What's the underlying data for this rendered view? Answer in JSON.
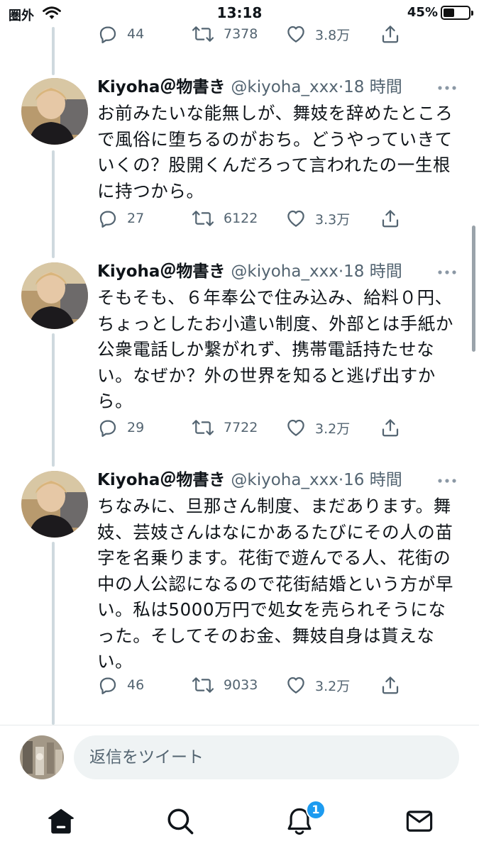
{
  "status_bar": {
    "carrier": "圏外",
    "time": "13:18",
    "battery_percent": "45%",
    "battery_level": 0.45
  },
  "top_actions": {
    "reply_count": "44",
    "retweet_count": "7378",
    "like_count": "3.8万"
  },
  "tweets": [
    {
      "name": "Kiyoha＠物書き",
      "handle": "@kiyoha_xxx",
      "time": "18 時間",
      "text": "お前みたいな能無しが、舞妓を辞めたところで風俗に堕ちるのがおち。どうやっていきていくの？股開くんだろって言われたの一生根に持つから。",
      "reply_count": "27",
      "retweet_count": "6122",
      "like_count": "3.3万"
    },
    {
      "name": "Kiyoha＠物書き",
      "handle": "@kiyoha_xxx",
      "time": "18 時間",
      "text": "そもそも、６年奉公で住み込み、給料０円、ちょっとしたお小遣い制度、外部とは手紙か公衆電話しか繋がれず、携帯電話持たせない。なぜか？外の世界を知ると逃げ出すから。",
      "reply_count": "29",
      "retweet_count": "7722",
      "like_count": "3.2万"
    },
    {
      "name": "Kiyoha＠物書き",
      "handle": "@kiyoha_xxx",
      "time": "16 時間",
      "text": "ちなみに、旦那さん制度、まだあります。舞妓、芸妓さんはなにかあるたびにその人の苗字を名乗ります。花街で遊んでる人、花街の中の人公認になるので花街結婚という方が早い。私は5000万円で処女を売られそうになった。そしてそのお金、舞妓自身は貰えない。",
      "reply_count": "46",
      "retweet_count": "9033",
      "like_count": "3.2万"
    }
  ],
  "compose": {
    "placeholder": "返信をツイート"
  },
  "tabbar": {
    "notification_badge": "1"
  },
  "colors": {
    "text": "#0f1419",
    "secondary": "#536471",
    "accent": "#1d9bf0",
    "divider": "#cfd9de"
  },
  "icons": [
    "wifi-icon",
    "battery-icon",
    "reply-icon",
    "retweet-icon",
    "like-icon",
    "share-icon",
    "more-icon",
    "home-icon",
    "search-icon",
    "notifications-icon",
    "messages-icon"
  ]
}
